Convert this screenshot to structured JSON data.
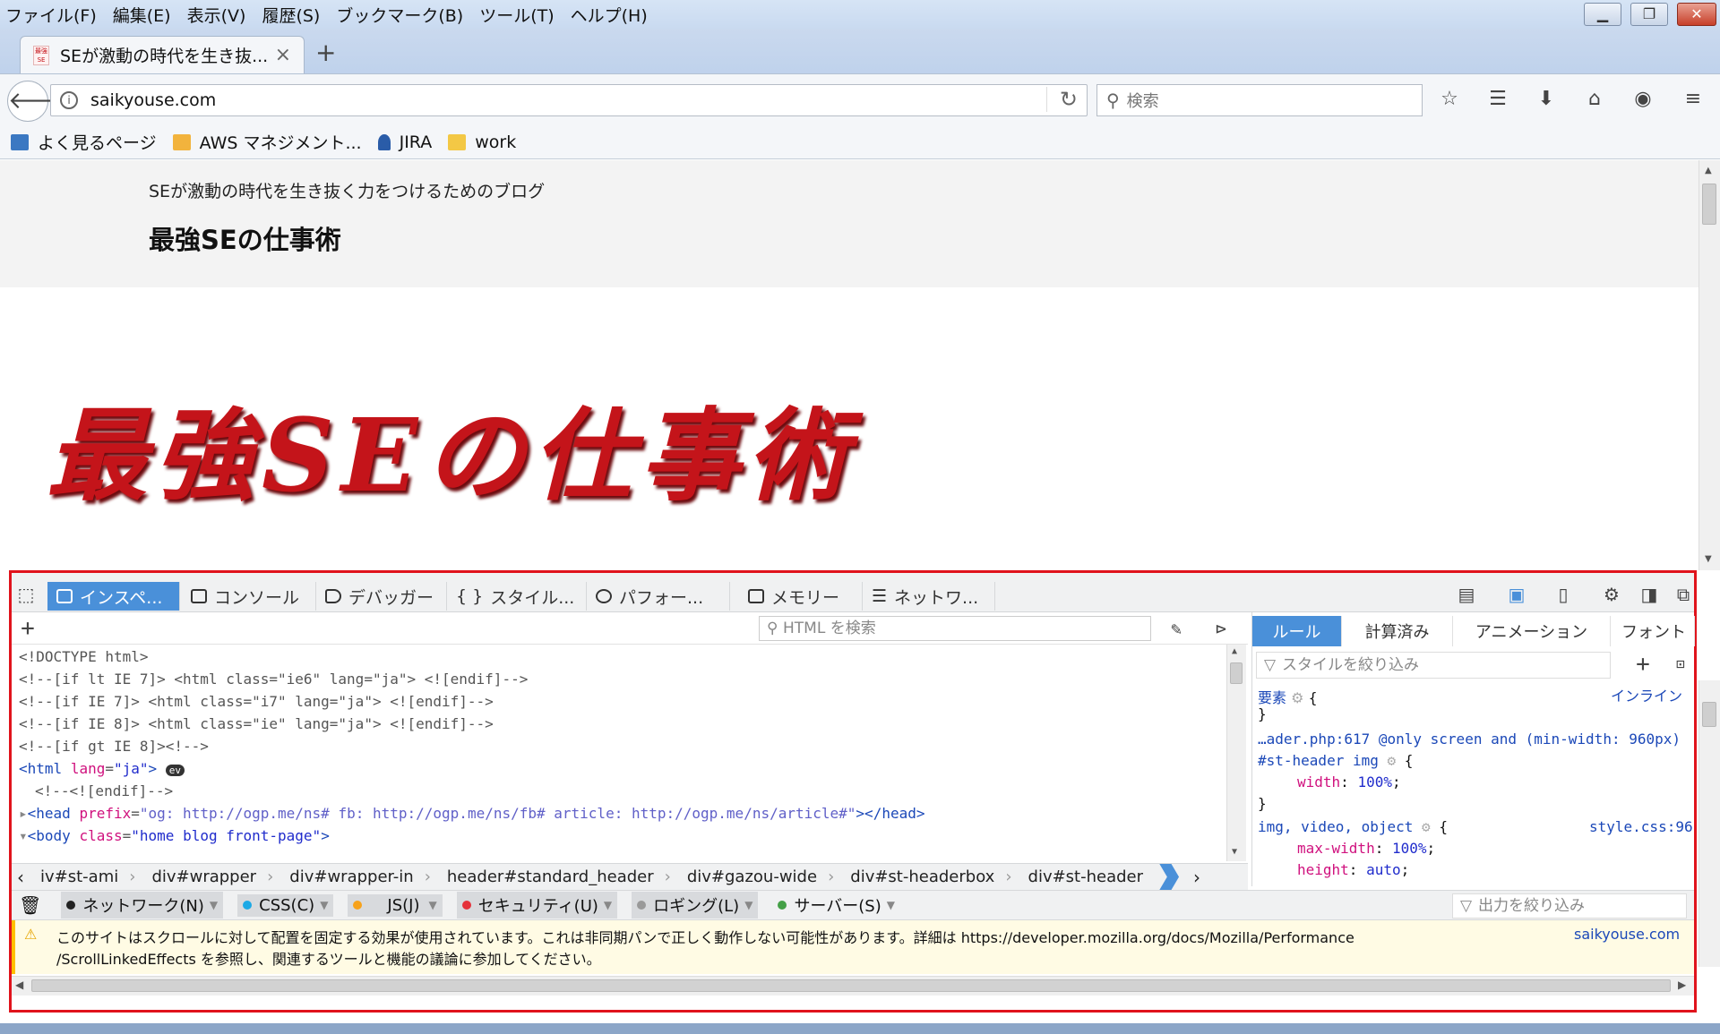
{
  "menubar": {
    "items": [
      "ファイル(F)",
      "編集(E)",
      "表示(V)",
      "履歴(S)",
      "ブックマーク(B)",
      "ツール(T)",
      "ヘルプ(H)"
    ]
  },
  "window": {
    "minimize": "▁",
    "restore": "❐",
    "close": "✕"
  },
  "tab": {
    "title": "SEが激動の時代を生き抜...",
    "favicon_text": "最強SE",
    "close": "×",
    "new_tab": "+"
  },
  "navbar": {
    "url": "saikyouse.com",
    "search_placeholder": "検索"
  },
  "bookmarks": [
    {
      "label": "よく見るページ",
      "color": "#3b78c2"
    },
    {
      "label": "AWS マネジメント...",
      "color": "#f2b33d"
    },
    {
      "label": "JIRA",
      "color": "#2a5ca8"
    },
    {
      "label": "work",
      "color": "#f3c845"
    }
  ],
  "page": {
    "tagline": "SEが激動の時代を生き抜く力をつけるためのブログ",
    "site_title": "最強SEの仕事術",
    "banner_text": "最強SEの仕事術",
    "banner_color": "#c4141a"
  },
  "devtools": {
    "tabs": [
      "インスペ...",
      "コンソール",
      "デバッガー",
      "スタイル...",
      "パフォー...",
      "メモリー",
      "ネットワ..."
    ],
    "html_search_placeholder": "HTML を検索",
    "rules_tabs": [
      "ルール",
      "計算済み",
      "アニメーション",
      "フォント"
    ],
    "rules_filter_placeholder": "スタイルを絞り込み",
    "markup_lines": [
      "<!DOCTYPE html>",
      "<!--[if lt IE 7]> <html class=\"ie6\" lang=\"ja\"> <![endif]-->",
      "<!--[if IE 7]> <html class=\"i7\" lang=\"ja\"> <![endif]-->",
      "<!--[if IE 8]> <html class=\"ie\" lang=\"ja\"> <![endif]-->",
      "<!--[if gt IE 8]><!-->"
    ],
    "html_tag": "html",
    "html_attr": "lang",
    "html_val": "\"ja\"",
    "ev_badge": "ev",
    "endif_comment": "<!--<![endif]-->",
    "head_line": {
      "tag": "head",
      "attr": "prefix",
      "val": "\"og: http://ogp.me/ns# fb: http://ogp.me/ns/fb# article: http://ogp.me/ns/article#\""
    },
    "body_line": {
      "tag": "body",
      "attr": "class",
      "val": "\"home blog front-page\""
    },
    "rules": {
      "element_label": "要素",
      "inline_label": "インライン",
      "media_rule": "…ader.php:617 @only screen and (min-width: 960px)",
      "selector1": "#st-header img",
      "prop1": "width",
      "val1": "100%",
      "selector2": "img, video, object",
      "source2": "style.css:96",
      "prop2": "max-width",
      "val2": "100%",
      "prop3": "height",
      "val3": "auto"
    },
    "breadcrumbs": [
      "iv#st-ami",
      "div#wrapper",
      "div#wrapper-in",
      "header#standard_header",
      "div#gazou-wide",
      "div#st-headerbox",
      "div#st-header"
    ],
    "console_filters": [
      {
        "label": "ネットワーク(N)",
        "color": "#222222"
      },
      {
        "label": "CSS(C)",
        "color": "#1ba9e6"
      },
      {
        "label": "JS(J)",
        "color": "#f7a21b"
      },
      {
        "label": "セキュリティ(U)",
        "color": "#e5313a"
      },
      {
        "label": "ロギング(L)",
        "color": "#999999"
      },
      {
        "label": "サーバー(S)",
        "color": "#44a047"
      }
    ],
    "output_filter_placeholder": "出力を絞り込み",
    "warning_line1": "このサイトはスクロールに対して配置を固定する効果が使用されています。これは非同期パンで正しく動作しない可能性があります。詳細は https://developer.mozilla.org/docs/Mozilla/Performance",
    "warning_line2": "/ScrollLinkedEffects を参照し、関連するツールと機能の議論に参加してください。",
    "warning_source": "saikyouse.com"
  }
}
